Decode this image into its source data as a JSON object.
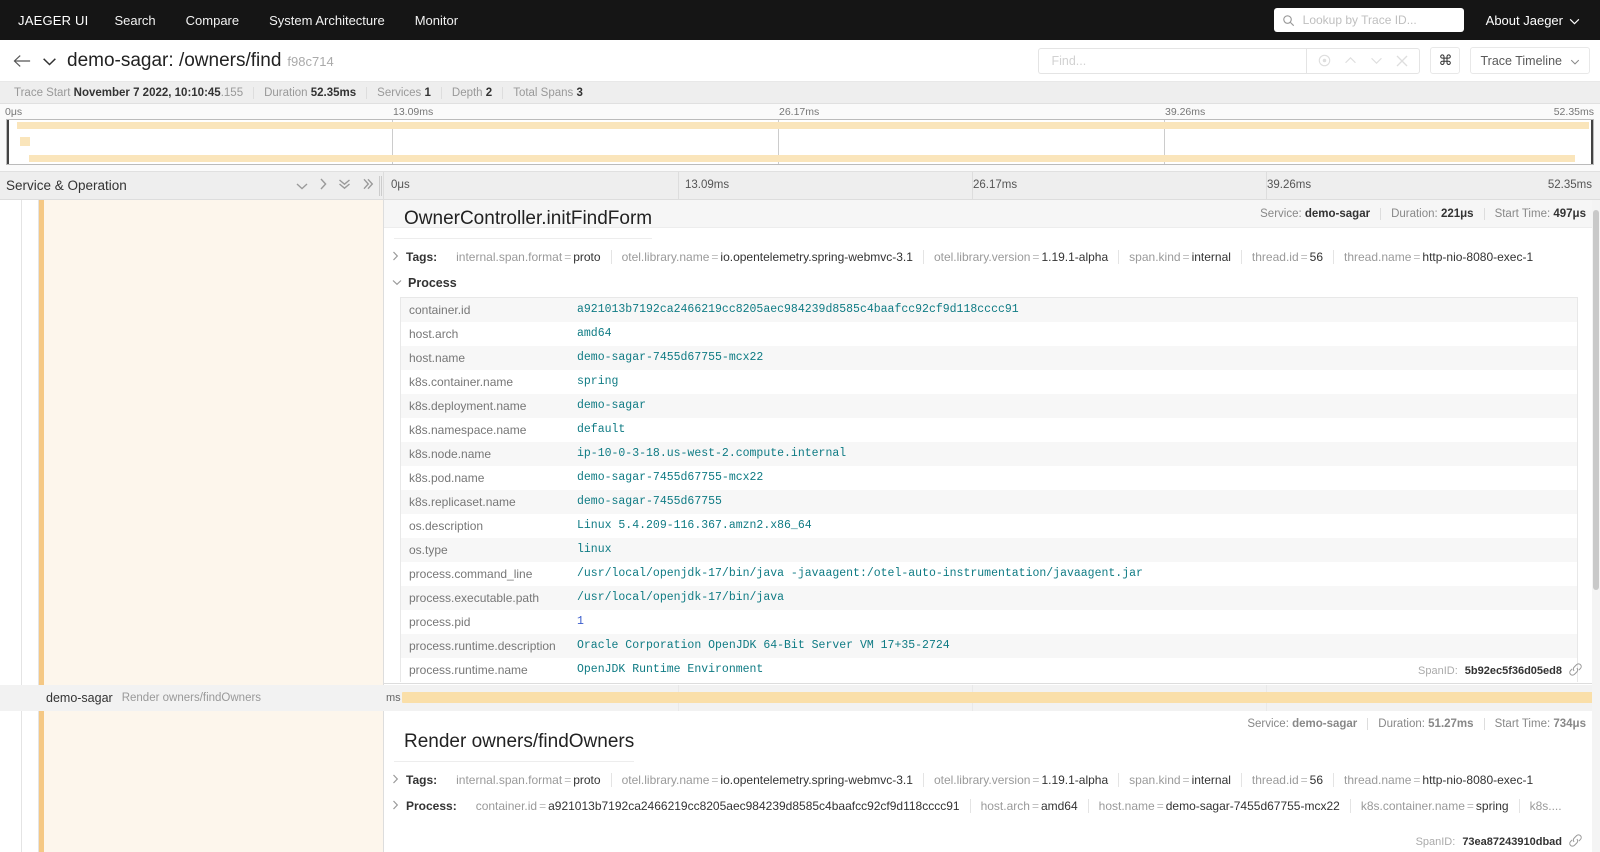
{
  "topnav": {
    "brand": "JAEGER UI",
    "items": [
      {
        "label": "Search"
      },
      {
        "label": "Compare"
      },
      {
        "label": "System Architecture"
      },
      {
        "label": "Monitor"
      }
    ],
    "lookup_placeholder": "Lookup by Trace ID...",
    "about_label": "About Jaeger"
  },
  "trace_header": {
    "back_icon": "arrow-left-icon",
    "service": "demo-sagar:",
    "operation": " /owners/find",
    "trace_id": "f98c714",
    "find_placeholder": "Find...",
    "kbd_label": "⌘",
    "view_mode": "Trace Timeline"
  },
  "summary": {
    "trace_start_label": "Trace Start",
    "trace_start_value": "November 7 2022, 10:10:45",
    "trace_start_frac": ".155",
    "duration_label": "Duration",
    "duration_value": "52.35ms",
    "services_label": "Services",
    "services_value": "1",
    "depth_label": "Depth",
    "depth_value": "2",
    "total_spans_label": "Total Spans",
    "total_spans_value": "3"
  },
  "ticks": [
    "0μs",
    "13.09ms",
    "26.17ms",
    "39.26ms",
    "52.35ms"
  ],
  "column_header": {
    "title": "Service & Operation",
    "icons": [
      "chevron-down-icon",
      "chevron-right-icon",
      "double-chevron-down-icon",
      "double-chevron-right-icon"
    ]
  },
  "span_detail_1": {
    "operation": "OwnerController.initFindForm",
    "service_label": "Service:",
    "service": "demo-sagar",
    "duration_label": "Duration:",
    "duration": "221μs",
    "start_label": "Start Time:",
    "start": "497μs",
    "tags_label": "Tags:",
    "tags": [
      {
        "k": "internal.span.format",
        "v": "proto"
      },
      {
        "k": "otel.library.name",
        "v": "io.opentelemetry.spring-webmvc-3.1"
      },
      {
        "k": "otel.library.version",
        "v": "1.19.1-alpha"
      },
      {
        "k": "span.kind",
        "v": "internal"
      },
      {
        "k": "thread.id",
        "v": "56"
      },
      {
        "k": "thread.name",
        "v": "http-nio-8080-exec-1"
      }
    ],
    "process_label": "Process",
    "process_rows": [
      {
        "k": "container.id",
        "v": "a921013b7192ca2466219cc8205aec984239d8585c4baafcc92cf9d118cccc91",
        "type": "string"
      },
      {
        "k": "host.arch",
        "v": "amd64",
        "type": "string"
      },
      {
        "k": "host.name",
        "v": "demo-sagar-7455d67755-mcx22",
        "type": "string"
      },
      {
        "k": "k8s.container.name",
        "v": "spring",
        "type": "string"
      },
      {
        "k": "k8s.deployment.name",
        "v": "demo-sagar",
        "type": "string"
      },
      {
        "k": "k8s.namespace.name",
        "v": "default",
        "type": "string"
      },
      {
        "k": "k8s.node.name",
        "v": "ip-10-0-3-18.us-west-2.compute.internal",
        "type": "string"
      },
      {
        "k": "k8s.pod.name",
        "v": "demo-sagar-7455d67755-mcx22",
        "type": "string"
      },
      {
        "k": "k8s.replicaset.name",
        "v": "demo-sagar-7455d67755",
        "type": "string"
      },
      {
        "k": "os.description",
        "v": "Linux 5.4.209-116.367.amzn2.x86_64",
        "type": "string"
      },
      {
        "k": "os.type",
        "v": "linux",
        "type": "string"
      },
      {
        "k": "process.command_line",
        "v": "/usr/local/openjdk-17/bin/java -javaagent:/otel-auto-instrumentation/javaagent.jar",
        "type": "string"
      },
      {
        "k": "process.executable.path",
        "v": "/usr/local/openjdk-17/bin/java",
        "type": "string"
      },
      {
        "k": "process.pid",
        "v": "1",
        "type": "number"
      },
      {
        "k": "process.runtime.description",
        "v": "Oracle Corporation OpenJDK 64-Bit Server VM 17+35-2724",
        "type": "string"
      },
      {
        "k": "process.runtime.name",
        "v": "OpenJDK Runtime Environment",
        "type": "string"
      }
    ],
    "spanid_label": "SpanID:",
    "spanid": "5b92ec5f36d05ed8",
    "link_icon": "link-icon"
  },
  "span_row": {
    "service": "demo-sagar",
    "operation": "Render owners/findOwners",
    "inline_tick": "ms"
  },
  "span_detail_2": {
    "operation": "Render owners/findOwners",
    "service_label": "Service:",
    "service": "demo-sagar",
    "duration_label": "Duration:",
    "duration": "51.27ms",
    "start_label": "Start Time:",
    "start": "734μs",
    "tags_label": "Tags:",
    "tags": [
      {
        "k": "internal.span.format",
        "v": "proto"
      },
      {
        "k": "otel.library.name",
        "v": "io.opentelemetry.spring-webmvc-3.1"
      },
      {
        "k": "otel.library.version",
        "v": "1.19.1-alpha"
      },
      {
        "k": "span.kind",
        "v": "internal"
      },
      {
        "k": "thread.id",
        "v": "56"
      },
      {
        "k": "thread.name",
        "v": "http-nio-8080-exec-1"
      }
    ],
    "process_label": "Process:",
    "process_inline": [
      {
        "k": "container.id",
        "v": "a921013b7192ca2466219cc8205aec984239d8585c4baafcc92cf9d118cccc91"
      },
      {
        "k": "host.arch",
        "v": "amd64"
      },
      {
        "k": "host.name",
        "v": "demo-sagar-7455d67755-mcx22"
      },
      {
        "k": "k8s.container.name",
        "v": "spring"
      },
      {
        "k": "k8s....",
        "v": ""
      }
    ],
    "spanid_label": "SpanID:",
    "spanid": "73ea87243910dbad"
  },
  "colors": {
    "nav_bg": "#151515",
    "span_bar": "#fadfa9",
    "accent": "#f5c884",
    "value_text": "#0f7b84",
    "number_text": "#3a5ccc"
  }
}
